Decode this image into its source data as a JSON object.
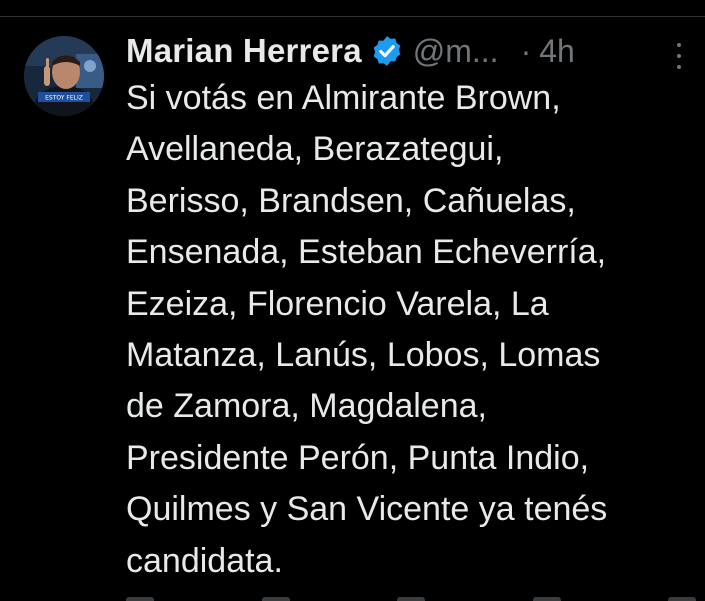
{
  "tweet": {
    "author": {
      "display_name": "Marian Herrera",
      "handle": "@m...",
      "verified": true,
      "avatar_caption": "ESTOY FELIZ"
    },
    "separator": "·",
    "timestamp": "4h",
    "text_lines": [
      "Si votás en Almirante Brown,",
      "Avellaneda, Berazategui,",
      "Berisso, Brandsen, Cañuelas,",
      "Ensenada, Esteban Echeverría,",
      "Ezeiza, Florencio Varela, La",
      "Matanza, Lanús, Lobos, Lomas",
      "de Zamora, Magdalena,",
      "Presidente Perón, Punta Indio,",
      "Quilmes y San Vicente ya tenés",
      "candidata."
    ]
  },
  "colors": {
    "background": "#000000",
    "text_primary": "#e7e9ea",
    "text_secondary": "#71767b",
    "verified_badge": "#1d9bf0",
    "divider": "#2f3336"
  },
  "icons": {
    "verified": "verified-badge-icon",
    "more": "more-options-icon"
  }
}
